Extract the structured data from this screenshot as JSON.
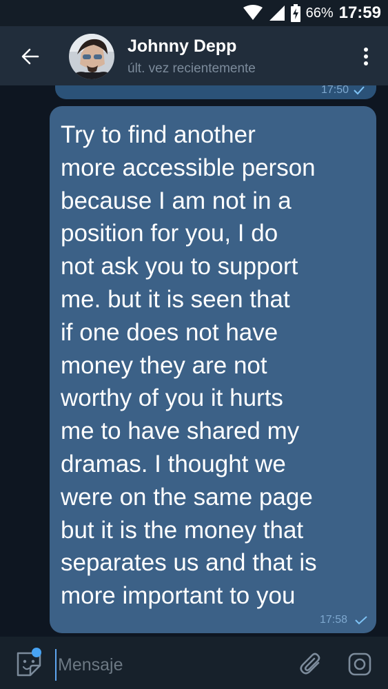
{
  "status_bar": {
    "battery": "66%",
    "time": "17:59"
  },
  "header": {
    "contact_name": "Johnny Depp",
    "contact_status": "últ. vez recientemente"
  },
  "chat": {
    "previous_message": {
      "time": "17:50"
    },
    "message": {
      "lines": [
        "Try to find another",
        "more accessible person",
        "because I am not in a",
        "position for you, I do",
        "not ask you to support",
        "me. but it is seen that",
        "if one does not have",
        "money they are not",
        "worthy of you it hurts",
        "me to have shared my",
        "dramas. I thought we",
        "were on the same page",
        "but it is the money that",
        "separates us and that is",
        "more important to you"
      ],
      "time": "17:58"
    }
  },
  "composer": {
    "placeholder": "Mensaje"
  },
  "colors": {
    "background": "#0e1621",
    "header": "#212d3b",
    "bubble_out": "#3c6187",
    "accent": "#47a3f3",
    "check": "#7ec3f5"
  },
  "icons": {
    "back": "arrow-left-icon",
    "menu": "more-vertical-icon",
    "sticker": "sticker-icon",
    "attach": "paperclip-icon",
    "camera": "camera-icon",
    "wifi": "wifi-icon",
    "signal": "signal-icon",
    "battery": "battery-charging-icon",
    "read": "check-icon"
  }
}
